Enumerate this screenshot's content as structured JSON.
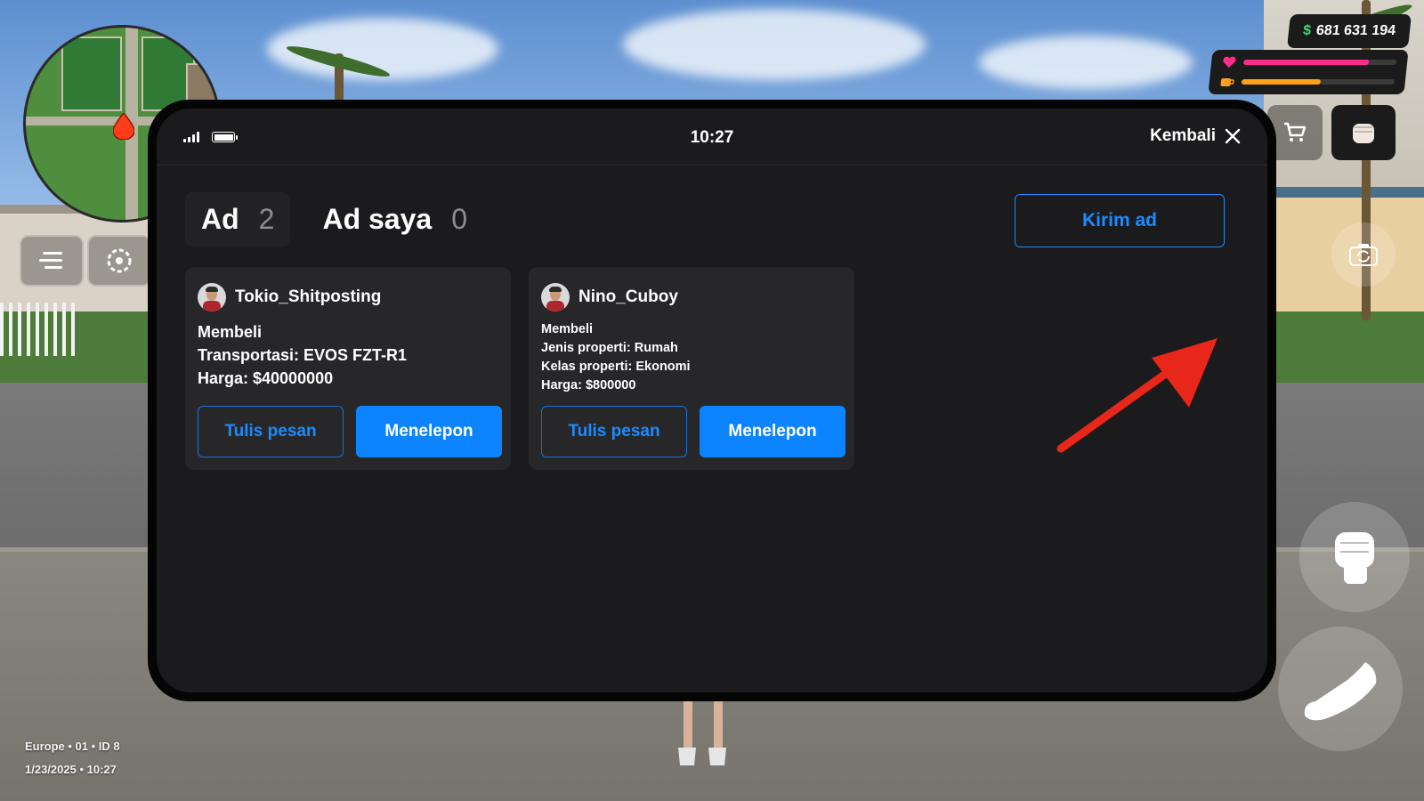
{
  "hud": {
    "money_symbol": "$",
    "money": "681 631 194",
    "health_percent": 82,
    "hunger_percent": 52,
    "colors": {
      "health": "#ff2d8a",
      "hunger": "#ff9f1a",
      "money_symbol": "#3ddc6b"
    },
    "icons": [
      "menu-icon",
      "settings-wheel-icon",
      "heart-icon",
      "food-icon",
      "cart-icon",
      "fist-icon",
      "camera-rotate-icon",
      "punch-icon",
      "sprint-icon"
    ]
  },
  "server_info": {
    "line1": "Europe • 01 • ID 8",
    "line2": "1/23/2025 • 10:27"
  },
  "phone": {
    "time": "10:27",
    "back_label": "Kembali",
    "tabs": [
      {
        "label": "Ad",
        "count": "2"
      },
      {
        "label": "Ad saya",
        "count": "0"
      }
    ],
    "send_ad_label": "Kirim ad",
    "accent": "#0d84ff",
    "cards": [
      {
        "name": "Tokio_Shitposting",
        "lines": [
          "Membeli",
          "Transportasi: EVOS FZT-R1",
          "Harga: $40000000"
        ],
        "message_label": "Tulis pesan",
        "call_label": "Menelepon"
      },
      {
        "name": "Nino_Cuboy",
        "lines": [
          "Membeli",
          "Jenis properti: Rumah",
          "Kelas properti: Ekonomi",
          "Harga: $800000"
        ],
        "message_label": "Tulis pesan",
        "call_label": "Menelepon"
      }
    ]
  }
}
